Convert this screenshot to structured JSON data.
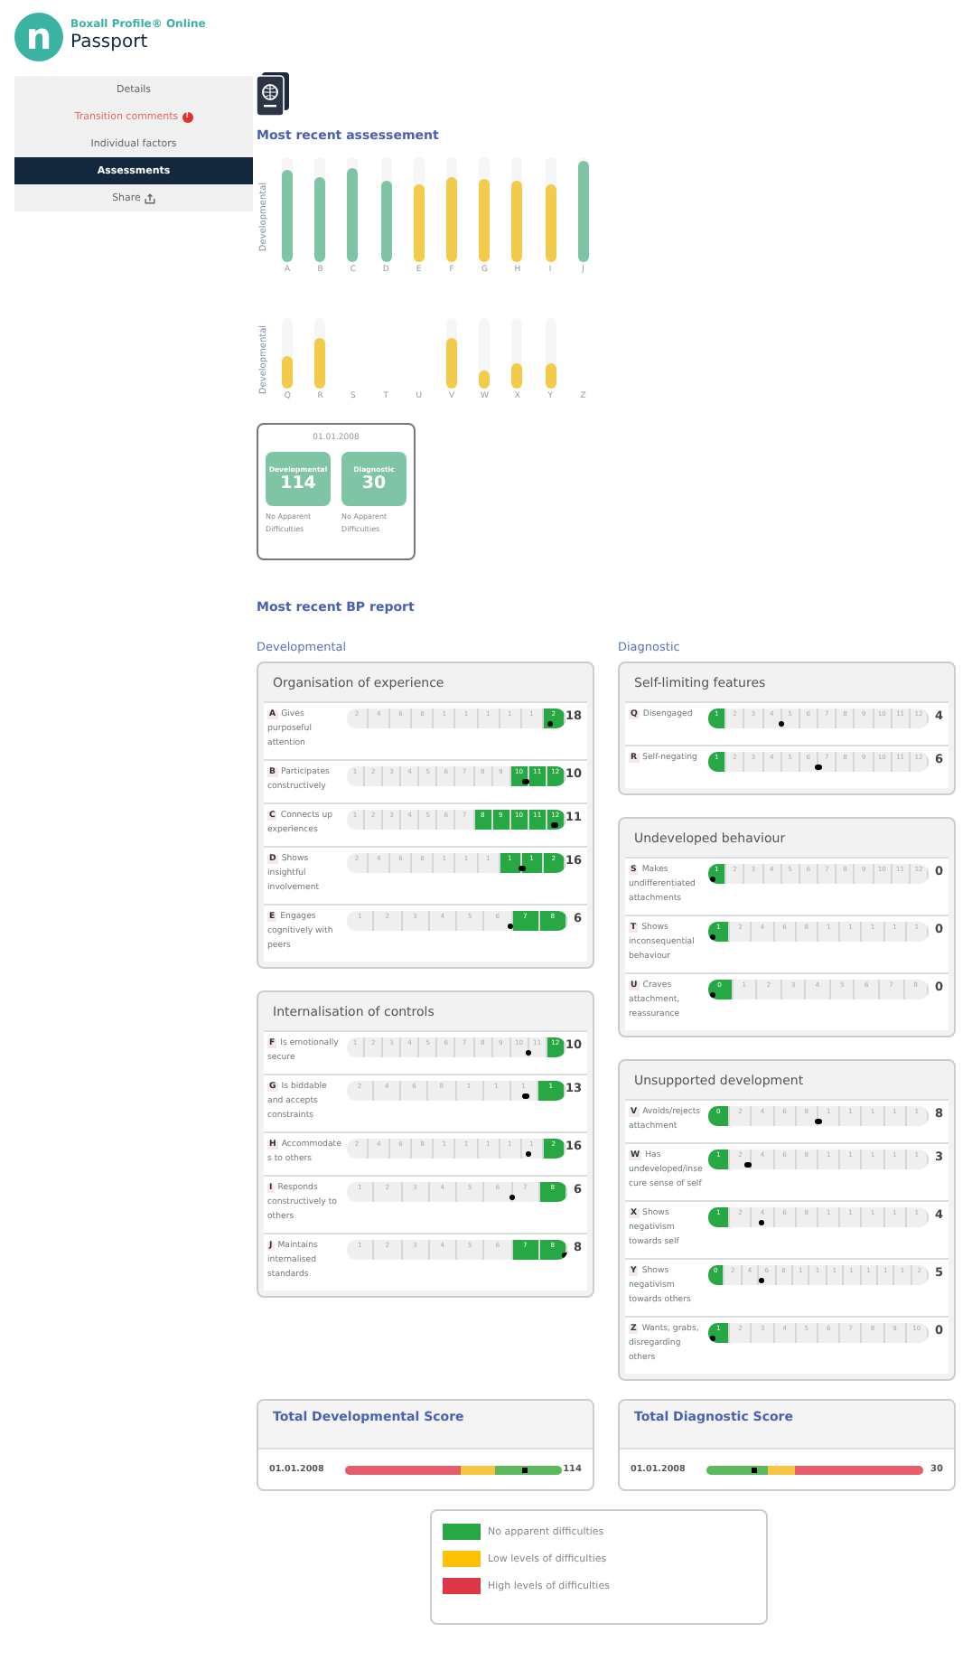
{
  "logo": {
    "mark": "n",
    "brand": "Boxall Profile® Online",
    "product": "Passport"
  },
  "sidebar": {
    "items": [
      {
        "label": "Details",
        "selected": false
      },
      {
        "label": "Transition comments",
        "selected": false,
        "badge": "!"
      },
      {
        "label": "Individual factors",
        "selected": false
      },
      {
        "label": "Assessments",
        "selected": true
      },
      {
        "label": "Share",
        "selected": false,
        "kind": "share"
      }
    ]
  },
  "assessment": {
    "title": "Most recent assessement",
    "charts": [
      {
        "axis_label": "Developmental",
        "bars": [
          {
            "label": "A",
            "level": 0.88,
            "color": "#7fc4a4"
          },
          {
            "label": "B",
            "level": 0.81,
            "color": "#7fc4a4"
          },
          {
            "label": "C",
            "level": 0.89,
            "color": "#7fc4a4"
          },
          {
            "label": "D",
            "level": 0.77,
            "color": "#7fc4a4"
          },
          {
            "label": "E",
            "level": 0.74,
            "color": "#f2cb4c"
          },
          {
            "label": "F",
            "level": 0.81,
            "color": "#f2cb4c"
          },
          {
            "label": "G",
            "level": 0.79,
            "color": "#f2cb4c"
          },
          {
            "label": "H",
            "level": 0.77,
            "color": "#f2cb4c"
          },
          {
            "label": "I",
            "level": 0.74,
            "color": "#f2cb4c"
          },
          {
            "label": "J",
            "level": 0.96,
            "color": "#7fc4a4"
          }
        ]
      },
      {
        "axis_label": "Developmental",
        "bars": [
          {
            "label": "Q",
            "level": 0.47,
            "color": "#f2cb4c"
          },
          {
            "label": "R",
            "level": 0.71,
            "color": "#f2cb4c"
          },
          {
            "label": "S"
          },
          {
            "label": "T"
          },
          {
            "label": "U"
          },
          {
            "label": "V",
            "level": 0.71,
            "color": "#f2cb4c"
          },
          {
            "label": "W",
            "level": 0.26,
            "color": "#f2cb4c"
          },
          {
            "label": "X",
            "level": 0.37,
            "color": "#f2cb4c"
          },
          {
            "label": "Y",
            "level": 0.37,
            "color": "#f2cb4c"
          },
          {
            "label": "Z"
          }
        ]
      }
    ],
    "card": {
      "date": "01.01.2008",
      "tiles": [
        {
          "title": "Developmental",
          "value": "114",
          "note": "No Apparent Difficulties"
        },
        {
          "title": "Diagnostic",
          "value": "30",
          "note": "No Apparent Difficulties"
        }
      ]
    }
  },
  "report": {
    "title": "Most recent BP report",
    "columns": [
      {
        "title": "Developmental",
        "panels": [
          {
            "title": "Organisation of experience",
            "items": [
              {
                "letter": "A",
                "text": "Gives purposeful attention",
                "score": "18",
                "level": 0.93,
                "segments": [
                  "2",
                  "4",
                  "6",
                  "8",
                  "1",
                  "1",
                  "1",
                  "1",
                  "1",
                  "2"
                ],
                "green": [
                  false,
                  false,
                  false,
                  false,
                  false,
                  false,
                  false,
                  false,
                  false,
                  true
                ]
              },
              {
                "letter": "B",
                "text": "Participates constructively",
                "score": "10",
                "level": 0.82,
                "segments": [
                  "1",
                  "2",
                  "3",
                  "4",
                  "5",
                  "6",
                  "7",
                  "8",
                  "9",
                  "10",
                  "11",
                  "12"
                ],
                "green": [
                  false,
                  false,
                  false,
                  false,
                  false,
                  false,
                  false,
                  false,
                  false,
                  true,
                  true,
                  true
                ]
              },
              {
                "letter": "C",
                "text": "Connects up experiences",
                "score": "11",
                "level": 0.95,
                "segments": [
                  "1",
                  "2",
                  "3",
                  "4",
                  "5",
                  "6",
                  "7",
                  "8",
                  "9",
                  "10",
                  "11",
                  "12"
                ],
                "green": [
                  false,
                  false,
                  false,
                  false,
                  false,
                  false,
                  false,
                  true,
                  true,
                  true,
                  true,
                  true
                ]
              },
              {
                "letter": "D",
                "text": "Shows insightful involvement",
                "score": "16",
                "level": 0.8,
                "segments": [
                  "2",
                  "4",
                  "6",
                  "8",
                  "1",
                  "1",
                  "1",
                  "1",
                  "1",
                  "2"
                ],
                "green": [
                  false,
                  false,
                  false,
                  false,
                  false,
                  false,
                  false,
                  true,
                  true,
                  true
                ]
              },
              {
                "letter": "E",
                "text": "Engages cognitively with peers",
                "score": "6",
                "level": 0.74,
                "segments": [
                  "1",
                  "2",
                  "3",
                  "4",
                  "5",
                  "6",
                  "7",
                  "8"
                ],
                "green": [
                  false,
                  false,
                  false,
                  false,
                  false,
                  false,
                  true,
                  true
                ]
              }
            ]
          },
          {
            "title": "Internalisation of controls",
            "items": [
              {
                "letter": "F",
                "text": "Is emotionally secure",
                "score": "10",
                "level": 0.83,
                "segments": [
                  "1",
                  "2",
                  "3",
                  "4",
                  "5",
                  "6",
                  "7",
                  "8",
                  "9",
                  "10",
                  "11",
                  "12"
                ],
                "green": [
                  false,
                  false,
                  false,
                  false,
                  false,
                  false,
                  false,
                  false,
                  false,
                  false,
                  false,
                  true
                ]
              },
              {
                "letter": "G",
                "text": "Is biddable and accepts constraints",
                "score": "13",
                "level": 0.82,
                "segments": [
                  "2",
                  "4",
                  "6",
                  "8",
                  "1",
                  "1",
                  "1",
                  "1"
                ],
                "green": [
                  false,
                  false,
                  false,
                  false,
                  false,
                  false,
                  false,
                  true
                ]
              },
              {
                "letter": "H",
                "text": "Accommodates to others",
                "score": "16",
                "level": 0.83,
                "segments": [
                  "2",
                  "4",
                  "6",
                  "8",
                  "1",
                  "1",
                  "1",
                  "1",
                  "1",
                  "2"
                ],
                "green": [
                  false,
                  false,
                  false,
                  false,
                  false,
                  false,
                  false,
                  false,
                  false,
                  true
                ]
              },
              {
                "letter": "I",
                "text": "Responds constructively to others",
                "score": "6",
                "level": 0.75,
                "segments": [
                  "1",
                  "2",
                  "3",
                  "4",
                  "5",
                  "6",
                  "7",
                  "8"
                ],
                "green": [
                  false,
                  false,
                  false,
                  false,
                  false,
                  false,
                  false,
                  true
                ]
              },
              {
                "letter": "J",
                "text": "Maintains internalised standards",
                "score": "8",
                "level": 0.99,
                "segments": [
                  "1",
                  "2",
                  "3",
                  "4",
                  "5",
                  "6",
                  "7",
                  "8"
                ],
                "green": [
                  false,
                  false,
                  false,
                  false,
                  false,
                  false,
                  true,
                  true
                ]
              }
            ]
          }
        ]
      },
      {
        "title": "Diagnostic",
        "panels": [
          {
            "title": "Self-limiting features",
            "items": [
              {
                "letter": "Q",
                "text": "Disengaged",
                "score": "4",
                "level": 0.33,
                "segments": [
                  "1",
                  "2",
                  "3",
                  "4",
                  "5",
                  "6",
                  "7",
                  "8",
                  "9",
                  "10",
                  "11",
                  "12"
                ],
                "green": [
                  true,
                  false,
                  false,
                  false,
                  false,
                  false,
                  false,
                  false,
                  false,
                  false,
                  false,
                  false
                ]
              },
              {
                "letter": "R",
                "text": "Self-negating",
                "score": "6",
                "level": 0.5,
                "segments": [
                  "1",
                  "2",
                  "3",
                  "4",
                  "5",
                  "6",
                  "7",
                  "8",
                  "9",
                  "10",
                  "11",
                  "12"
                ],
                "green": [
                  true,
                  false,
                  false,
                  false,
                  false,
                  false,
                  false,
                  false,
                  false,
                  false,
                  false,
                  false
                ]
              }
            ]
          },
          {
            "title": "Undeveloped behaviour",
            "items": [
              {
                "letter": "S",
                "text": "Makes undifferentiated attachments",
                "score": "0",
                "level": 0.02,
                "segments": [
                  "1",
                  "2",
                  "3",
                  "4",
                  "5",
                  "6",
                  "7",
                  "8",
                  "9",
                  "10",
                  "11",
                  "12"
                ],
                "green": [
                  true,
                  false,
                  false,
                  false,
                  false,
                  false,
                  false,
                  false,
                  false,
                  false,
                  false,
                  false
                ]
              },
              {
                "letter": "T",
                "text": "Shows inconsequential behaviour",
                "score": "0",
                "level": 0.02,
                "segments": [
                  "1",
                  "2",
                  "4",
                  "6",
                  "8",
                  "1",
                  "1",
                  "1",
                  "1",
                  "1"
                ],
                "green": [
                  true,
                  false,
                  false,
                  false,
                  false,
                  false,
                  false,
                  false,
                  false,
                  false
                ]
              },
              {
                "letter": "U",
                "text": "Craves attachment, reassurance",
                "score": "0",
                "level": 0.02,
                "segments": [
                  "0",
                  "1",
                  "2",
                  "3",
                  "4",
                  "5",
                  "6",
                  "7",
                  "8"
                ],
                "green": [
                  true,
                  false,
                  false,
                  false,
                  false,
                  false,
                  false,
                  false,
                  false
                ]
              }
            ]
          },
          {
            "title": "Unsupported development",
            "items": [
              {
                "letter": "V",
                "text": "Avoids/rejects attachment",
                "score": "8",
                "level": 0.5,
                "segments": [
                  "0",
                  "2",
                  "4",
                  "6",
                  "8",
                  "1",
                  "1",
                  "1",
                  "1",
                  "1"
                ],
                "green": [
                  true,
                  false,
                  false,
                  false,
                  false,
                  false,
                  false,
                  false,
                  false,
                  false
                ]
              },
              {
                "letter": "W",
                "text": "Has undeveloped/insecure sense of self",
                "score": "3",
                "level": 0.18,
                "segments": [
                  "1",
                  "2",
                  "4",
                  "6",
                  "8",
                  "1",
                  "1",
                  "1",
                  "1",
                  "1"
                ],
                "green": [
                  true,
                  false,
                  false,
                  false,
                  false,
                  false,
                  false,
                  false,
                  false,
                  false
                ]
              },
              {
                "letter": "X",
                "text": "Shows negativism towards self",
                "score": "4",
                "level": 0.24,
                "segments": [
                  "1",
                  "2",
                  "4",
                  "6",
                  "8",
                  "1",
                  "1",
                  "1",
                  "1",
                  "1"
                ],
                "green": [
                  true,
                  false,
                  false,
                  false,
                  false,
                  false,
                  false,
                  false,
                  false,
                  false
                ]
              },
              {
                "letter": "Y",
                "text": "Shows negativism towards others",
                "score": "5",
                "level": 0.24,
                "segments": [
                  "0",
                  "2",
                  "4",
                  "6",
                  "8",
                  "1",
                  "1",
                  "1",
                  "1",
                  "1",
                  "1",
                  "1",
                  "2"
                ],
                "green": [
                  true,
                  false,
                  false,
                  false,
                  false,
                  false,
                  false,
                  false,
                  false,
                  false,
                  false,
                  false,
                  false
                ]
              },
              {
                "letter": "Z",
                "text": "Wants, grabs, disregarding others",
                "score": "0",
                "level": 0.02,
                "segments": [
                  "1",
                  "2",
                  "3",
                  "4",
                  "5",
                  "6",
                  "7",
                  "8",
                  "9",
                  "10"
                ],
                "green": [
                  true,
                  false,
                  false,
                  false,
                  false,
                  false,
                  false,
                  false,
                  false,
                  false
                ]
              }
            ]
          }
        ]
      }
    ]
  },
  "totals": [
    {
      "title": "Total Developmental Score",
      "date": "01.01.2008",
      "score": "114",
      "level": 0.83,
      "bands": [
        {
          "color": "#e35d6a"
        },
        {
          "color": "#f7c744"
        },
        {
          "color": "#5cb85c"
        }
      ]
    },
    {
      "title": "Total Diagnostic Score",
      "date": "01.01.2008",
      "score": "30",
      "level": 0.22,
      "bands": [
        {
          "color": "#5cb85c"
        },
        {
          "color": "#f7c744"
        },
        {
          "color": "#e35d6a"
        }
      ]
    }
  ],
  "legend": [
    {
      "label": "No apparent difficulties",
      "color": "#28a745"
    },
    {
      "label": "Low levels of difficulties",
      "color": "#ffc107"
    },
    {
      "label": "High levels of difficulties",
      "color": "#dc3545"
    }
  ]
}
